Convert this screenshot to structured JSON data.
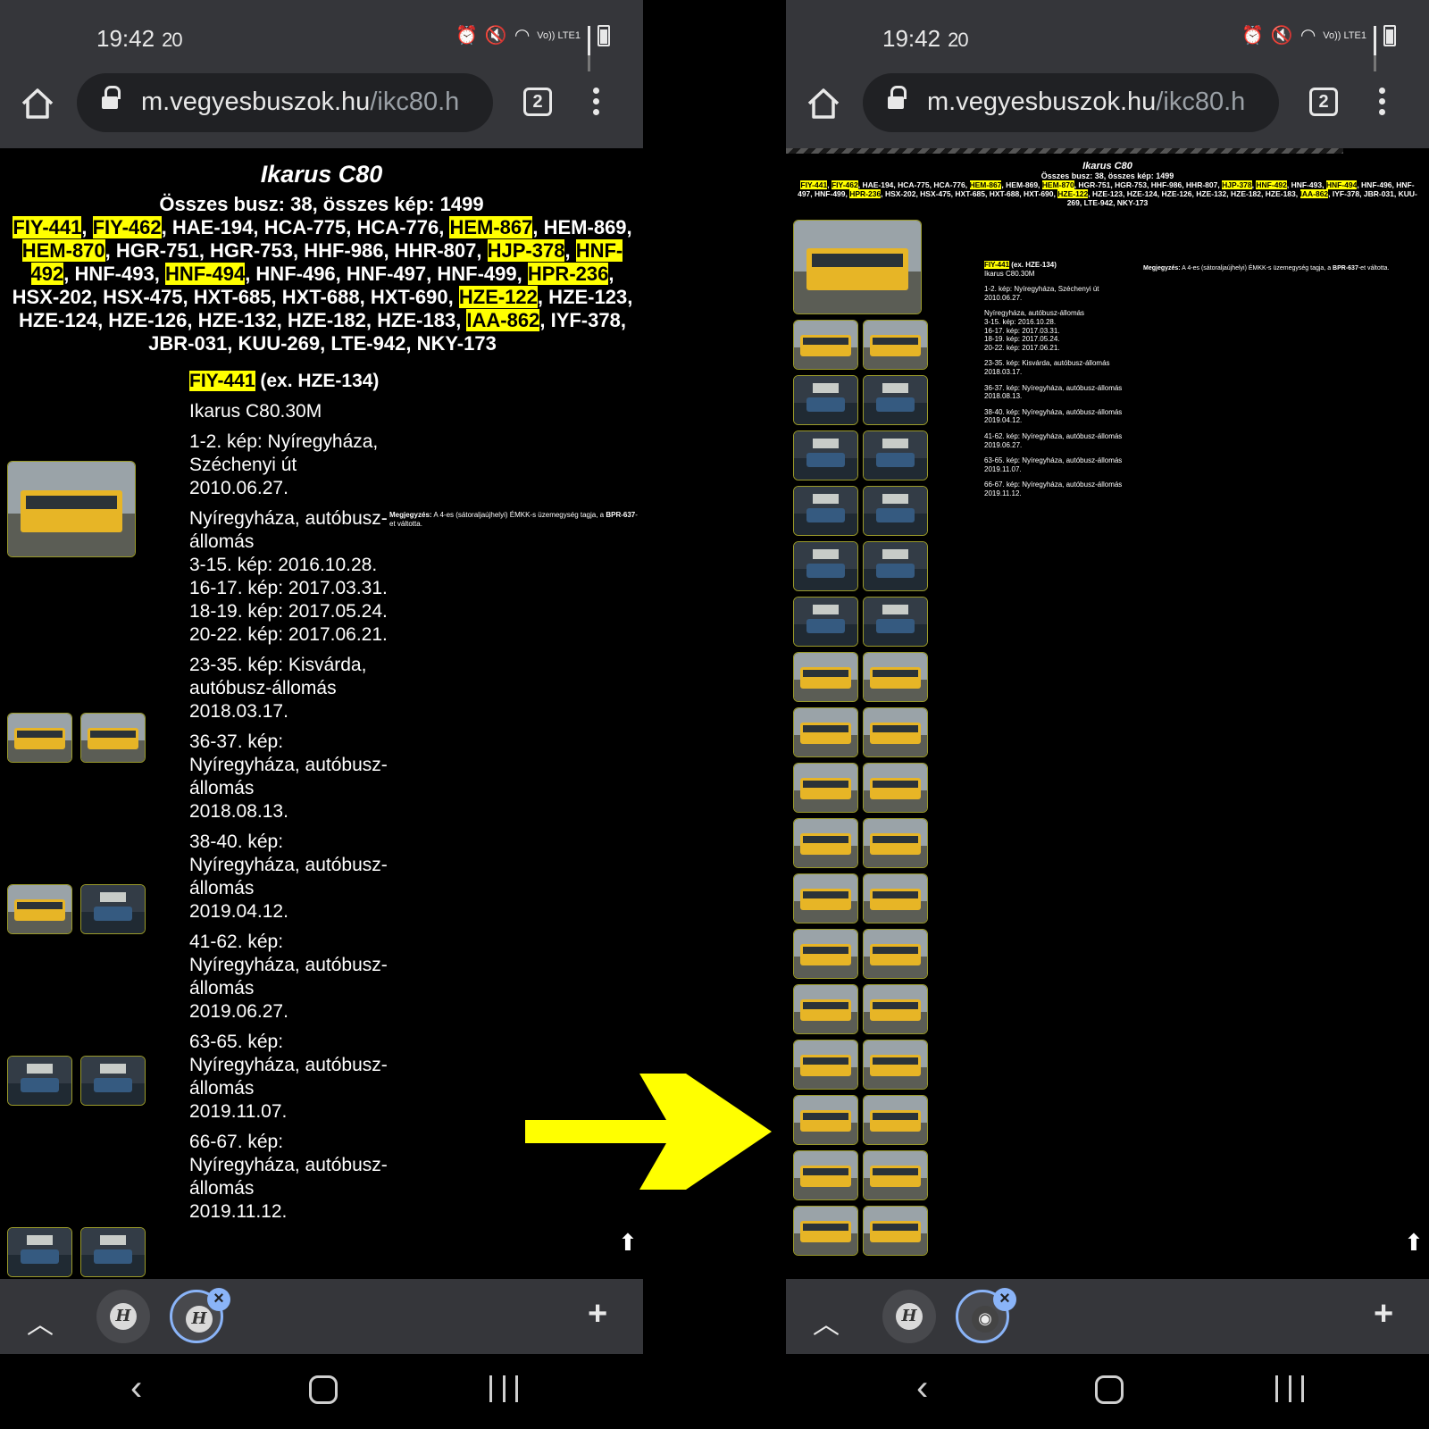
{
  "status": {
    "time": "19:42",
    "extra": "20",
    "volte": "Vo)) LTE1"
  },
  "browser": {
    "url_domain": "m.vegyesbuszok.hu",
    "url_path": "/ikc80.h",
    "tab_count": "2",
    "tabbar_favicon": "H"
  },
  "page": {
    "title": "Ikarus C80",
    "summary": "Összes busz: 38, összes kép: 1499",
    "plates": [
      {
        "id": "FIY-441",
        "hl": true
      },
      {
        "id": "FIY-462",
        "hl": true
      },
      {
        "id": "HAE-194",
        "hl": false
      },
      {
        "id": "HCA-775",
        "hl": false
      },
      {
        "id": "HCA-776",
        "hl": false
      },
      {
        "id": "HEM-867",
        "hl": true
      },
      {
        "id": "HEM-869",
        "hl": false
      },
      {
        "id": "HEM-870",
        "hl": true
      },
      {
        "id": "HGR-751",
        "hl": false
      },
      {
        "id": "HGR-753",
        "hl": false
      },
      {
        "id": "HHF-986",
        "hl": false
      },
      {
        "id": "HHR-807",
        "hl": false
      },
      {
        "id": "HJP-378",
        "hl": true
      },
      {
        "id": "HNF-492",
        "hl": true
      },
      {
        "id": "HNF-493",
        "hl": false
      },
      {
        "id": "HNF-494",
        "hl": true
      },
      {
        "id": "HNF-496",
        "hl": false
      },
      {
        "id": "HNF-497",
        "hl": false
      },
      {
        "id": "HNF-499",
        "hl": false
      },
      {
        "id": "HPR-236",
        "hl": true
      },
      {
        "id": "HSX-202",
        "hl": false
      },
      {
        "id": "HSX-475",
        "hl": false
      },
      {
        "id": "HXT-685",
        "hl": false
      },
      {
        "id": "HXT-688",
        "hl": false
      },
      {
        "id": "HXT-690",
        "hl": false
      },
      {
        "id": "HZE-122",
        "hl": true
      },
      {
        "id": "HZE-123",
        "hl": false
      },
      {
        "id": "HZE-124",
        "hl": false
      },
      {
        "id": "HZE-126",
        "hl": false
      },
      {
        "id": "HZE-132",
        "hl": false
      },
      {
        "id": "HZE-182",
        "hl": false
      },
      {
        "id": "HZE-183",
        "hl": false
      },
      {
        "id": "IAA-862",
        "hl": true
      },
      {
        "id": "IYF-378",
        "hl": false
      },
      {
        "id": "JBR-031",
        "hl": false
      },
      {
        "id": "KUU-269",
        "hl": false
      },
      {
        "id": "LTE-942",
        "hl": false
      },
      {
        "id": "NKY-173",
        "hl": false
      }
    ],
    "bus": {
      "plate": "FIY-441",
      "ex": " (ex. HZE-134)",
      "model": "Ikarus C80.30M",
      "blocks": [
        [
          "1-2. kép: Nyíregyháza, Széchenyi út",
          "2010.06.27."
        ],
        [
          "Nyíregyháza, autóbusz-állomás",
          "3-15. kép: 2016.10.28.",
          "16-17. kép: 2017.03.31.",
          "18-19. kép: 2017.05.24.",
          "20-22. kép: 2017.06.21."
        ],
        [
          "23-35. kép: Kisvárda, autóbusz-állomás",
          "2018.03.17."
        ],
        [
          "36-37. kép: Nyíregyháza, autóbusz-állomás",
          "2018.08.13."
        ],
        [
          "38-40. kép: Nyíregyháza, autóbusz-állomás",
          "2019.04.12."
        ],
        [
          "41-62. kép: Nyíregyháza, autóbusz-állomás",
          "2019.06.27."
        ],
        [
          "63-65. kép: Nyíregyháza, autóbusz-állomás",
          "2019.11.07."
        ],
        [
          "66-67. kép: Nyíregyháza, autóbusz-állomás",
          "2019.11.12."
        ]
      ],
      "note_label": "Megjegyzés:",
      "note_text": " A 4-es (sátoraljaújhelyi) ÉMKK-s üzemegység tagja, a ",
      "note_plate": "BPR-637",
      "note_tail": "-et váltotta."
    }
  },
  "colors": {
    "highlight": "#ffff00",
    "chrome": "#35363a",
    "accent": "#8ab4f8",
    "arrow": "#ffff00"
  },
  "icons": [
    "home-icon",
    "lock-icon",
    "tabs-icon",
    "menu-icon",
    "chevron-up-icon",
    "close-icon",
    "plus-icon",
    "back-icon",
    "home-nav-icon",
    "recents-icon",
    "scroll-top-arrow-icon",
    "transition-arrow-icon"
  ]
}
